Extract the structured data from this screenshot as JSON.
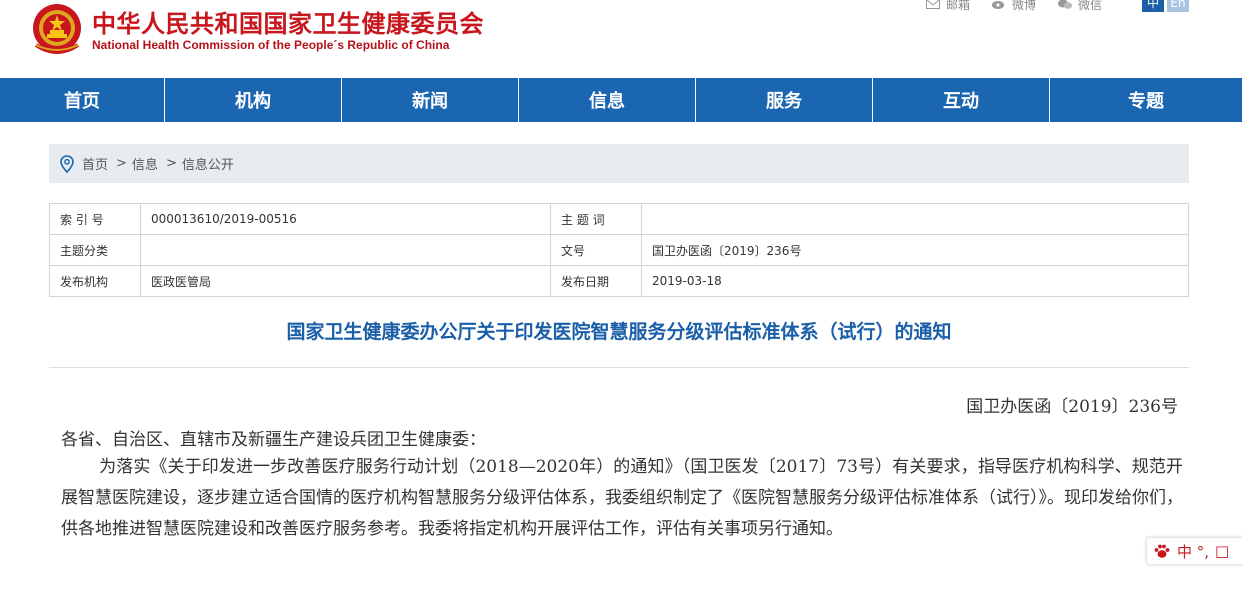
{
  "header": {
    "title_cn": "中华人民共和国国家卫生健康委员会",
    "title_en": "National Health Commission of the People´s Republic of China",
    "links": [
      {
        "label": "邮箱",
        "icon": "mail-icon"
      },
      {
        "label": "微博",
        "icon": "weibo-icon"
      },
      {
        "label": "微信",
        "icon": "wechat-icon"
      }
    ],
    "lang_zh": "中",
    "lang_en": "En"
  },
  "nav": {
    "items": [
      "首页",
      "机构",
      "新闻",
      "信息",
      "服务",
      "互动",
      "专题"
    ]
  },
  "breadcrumb": {
    "items": [
      "首页",
      "信息",
      "信息公开"
    ],
    "separator": ">"
  },
  "info_table": {
    "rows": [
      [
        "索 引 号",
        "000013610/2019-00516",
        "主 题 词",
        ""
      ],
      [
        "主题分类",
        "",
        "文号",
        "国卫办医函〔2019〕236号"
      ],
      [
        "发布机构",
        "医政医管局",
        "发布日期",
        "2019-03-18"
      ]
    ]
  },
  "document": {
    "title": "国家卫生健康委办公厅关于印发医院智慧服务分级评估标准体系（试行）的通知",
    "doc_number": "国卫办医函〔2019〕236号",
    "addressee": "各省、自治区、直辖市及新疆生产建设兵团卫生健康委：",
    "paragraph": "为落实《关于印发进一步改善医疗服务行动计划（2018—2020年）的通知》（国卫医发〔2017〕73号）有关要求，指导医疗机构科学、规范开展智慧医院建设，逐步建立适合国情的医疗机构智慧服务分级评估体系，我委组织制定了《医院智慧服务分级评估标准体系（试行）》。现印发给你们，供各地推进智慧医院建设和改善医疗服务参考。我委将指定机构开展评估工作，评估有关事项另行通知。"
  },
  "ime": {
    "label": "中 °,",
    "square": "□"
  },
  "colors": {
    "brand_red": "#c8161d",
    "nav_blue": "#1b66b1",
    "title_blue": "#1a5fa7"
  }
}
